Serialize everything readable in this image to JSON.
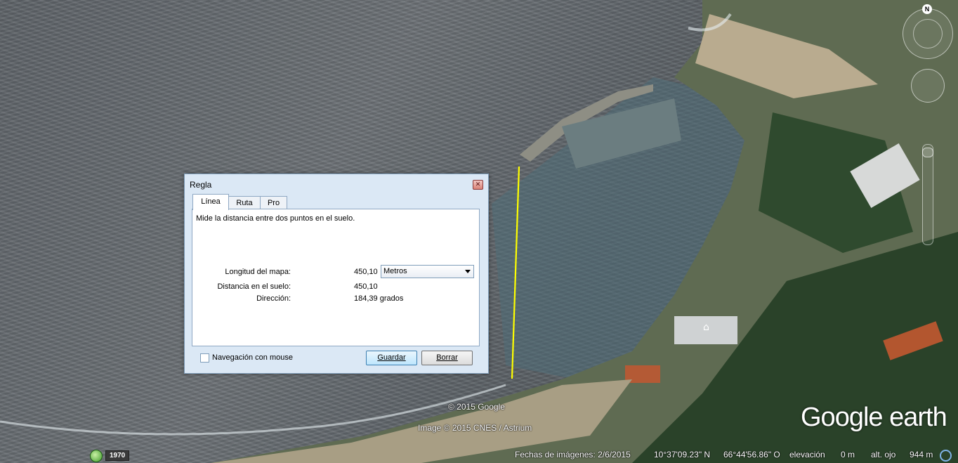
{
  "dialog": {
    "title": "Regla",
    "tabs": [
      {
        "label": "Línea",
        "active": true
      },
      {
        "label": "Ruta",
        "active": false
      },
      {
        "label": "Pro",
        "active": false
      }
    ],
    "description": "Mide la distancia entre dos puntos en el suelo.",
    "map_length_label": "Longitud del mapa:",
    "map_length_value": "450,10",
    "units_selected": "Metros",
    "ground_distance_label": "Distancia en el suelo:",
    "ground_distance_value": "450,10",
    "heading_label": "Dirección:",
    "heading_value": "184,39 grados",
    "mouse_nav_label": "Navegación con mouse",
    "mouse_nav_checked": false,
    "save_button": "Guardar",
    "clear_button": "Borrar"
  },
  "map": {
    "copyright_google": "© 2015 Google",
    "copyright_image": "Image © 2015 CNES / Astrium",
    "logo_text": "Google earth",
    "compass_north": "N",
    "measure_line_color": "#ffff00"
  },
  "status_bar": {
    "historical_year": "1970",
    "imagery_date": "Fechas de imágenes: 2/6/2015",
    "latitude": "10°37'09.23\" N",
    "longitude": "66°44'56.86\" O",
    "elevation_label": "elevación",
    "elevation_value": "0 m",
    "eye_alt_label": "alt. ojo",
    "eye_alt_value": "944 m"
  }
}
